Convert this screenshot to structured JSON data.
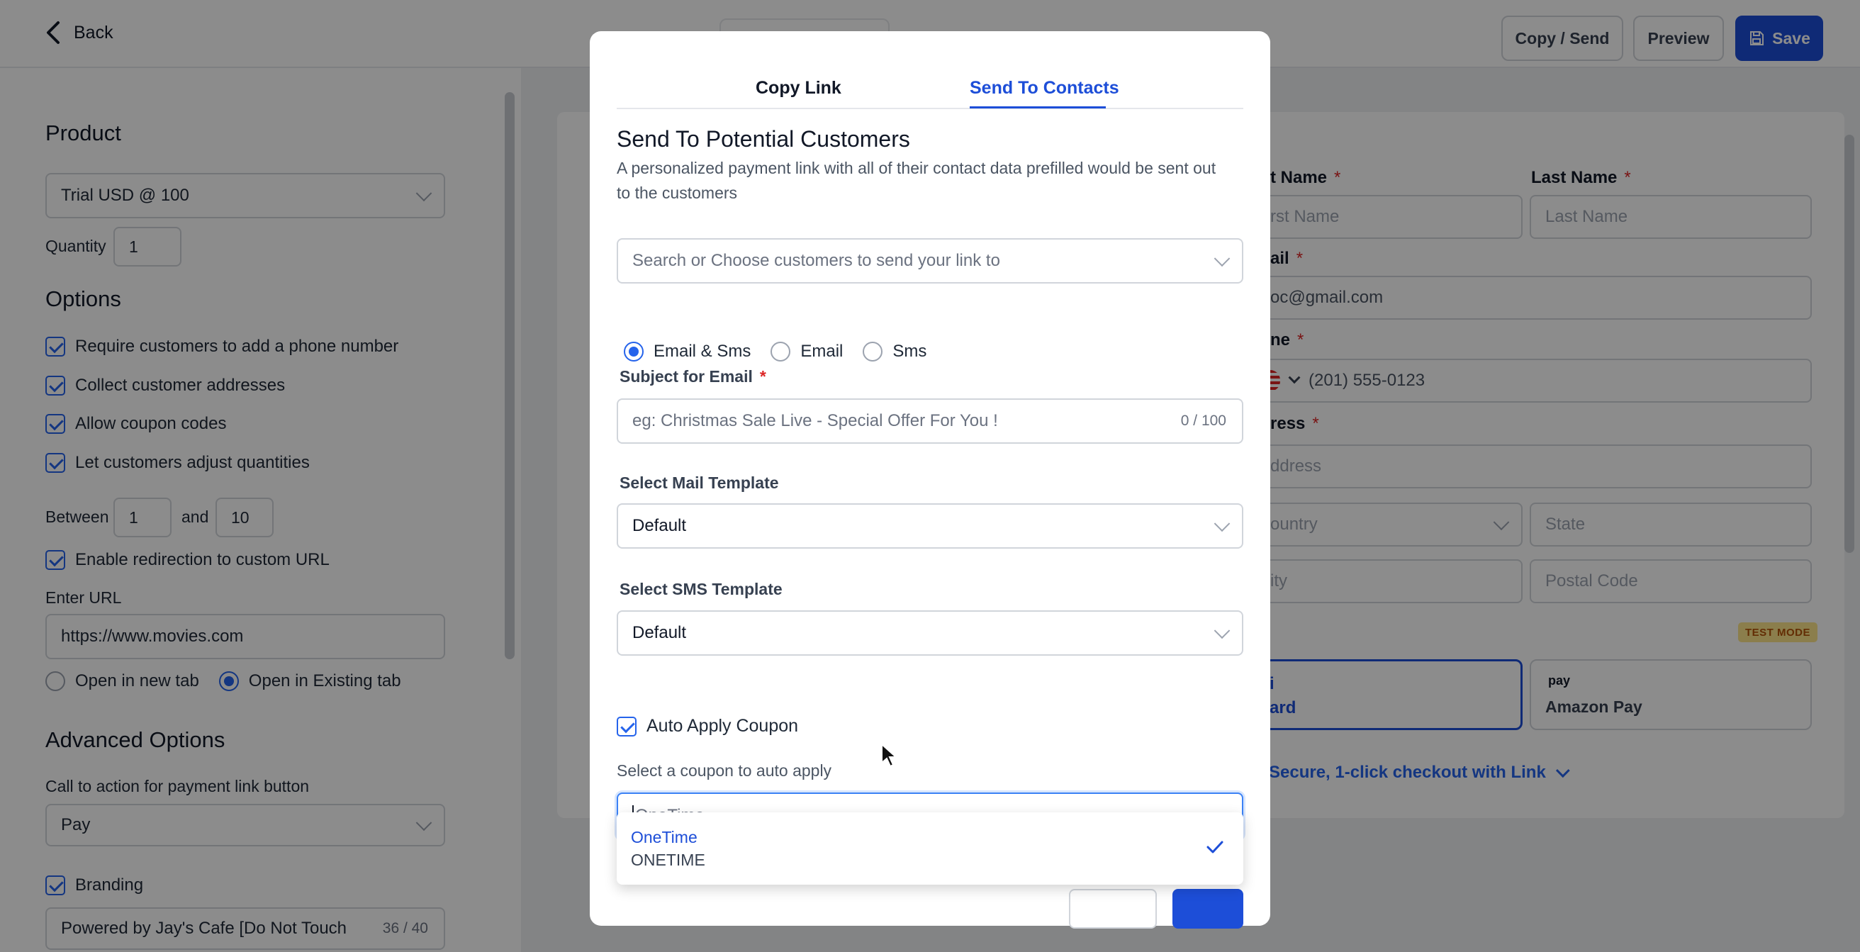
{
  "topbar": {
    "back_label": "Back",
    "copy_send_label": "Copy / Send",
    "preview_label": "Preview",
    "save_label": "Save"
  },
  "left": {
    "product_heading": "Product",
    "product_value": "Trial USD @ 100",
    "quantity_label": "Quantity",
    "quantity_value": "1",
    "options_heading": "Options",
    "options": [
      "Require customers to add a phone number",
      "Collect customer addresses",
      "Allow coupon codes",
      "Let customers adjust quantities"
    ],
    "between_label": "Between",
    "between_min": "1",
    "and_label": "and",
    "between_max": "10",
    "redirect_label": "Enable redirection to custom URL",
    "url_label": "Enter URL",
    "url_value": "https://www.movies.com",
    "open_new_tab": "Open in new tab",
    "open_existing_tab": "Open in Existing tab",
    "advanced_heading": "Advanced Options",
    "cta_label": "Call to action for payment link button",
    "cta_value": "Pay",
    "branding_label": "Branding",
    "branding_value": "Powered by Jay's Cafe [Do Not Touch",
    "branding_counter": "36 / 40"
  },
  "preview": {
    "first_name_label": "t Name",
    "first_name_ph": "rst Name",
    "last_name_label": "Last Name",
    "last_name_ph": "Last Name",
    "email_label": "ail",
    "email_value": "oc@gmail.com",
    "phone_label": "ne",
    "phone_value": "(201) 555-0123",
    "address_label": "ress",
    "address_ph": "ddress",
    "country_ph": "ountry",
    "state_ph": "State",
    "city_ph": "ity",
    "postal_ph": "Postal Code",
    "test_mode": "TEST MODE",
    "card_partial_top": "i",
    "card_label": "ard",
    "amazon_logo": "pay",
    "amazon_label": "Amazon Pay",
    "link_text": "Secure, 1-click checkout with Link"
  },
  "modal": {
    "tab_copy_link": "Copy Link",
    "tab_send_contacts": "Send To Contacts",
    "title": "Send To Potential Customers",
    "description": "A personalized payment link with all of their contact data prefilled would be sent out to the customers",
    "search_placeholder": "Search or Choose customers to send your link to",
    "channel_options": [
      "Email & Sms",
      "Email",
      "Sms"
    ],
    "subject_label": "Subject for Email",
    "subject_placeholder": "eg: Christmas Sale Live - Special Offer For You !",
    "subject_counter": "0 / 100",
    "mail_template_label": "Select Mail Template",
    "mail_template_value": "Default",
    "sms_template_label": "Select SMS Template",
    "sms_template_value": "Default",
    "auto_apply_label": "Auto Apply Coupon",
    "coupon_label": "Select a coupon to auto apply",
    "coupon_value": "OneTime"
  },
  "dropdown": {
    "option_name": "OneTime",
    "option_code": "ONETIME"
  },
  "colors": {
    "accent": "#1d4ed8",
    "required": "#dc2626",
    "test_badge_bg": "#fde68a"
  }
}
